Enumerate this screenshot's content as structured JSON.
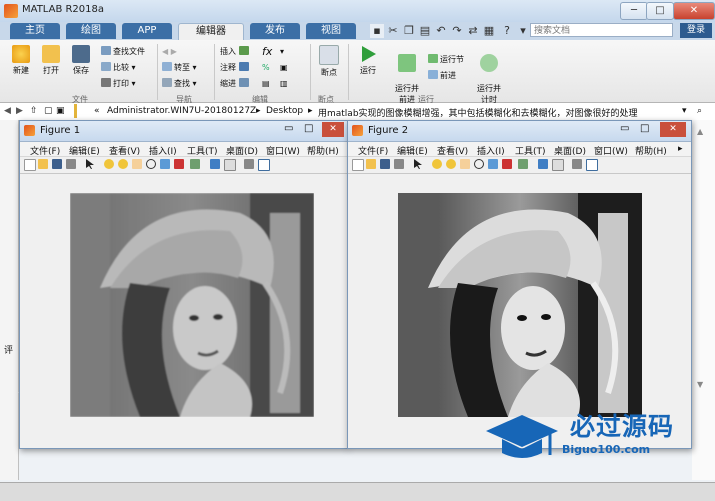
{
  "app": {
    "title": "MATLAB R2018a"
  },
  "window_controls": {
    "minimize": "─",
    "maximize": "□",
    "close": "✕"
  },
  "tabs": [
    {
      "label": "主页"
    },
    {
      "label": "绘图"
    },
    {
      "label": "APP"
    },
    {
      "label": "编辑器"
    },
    {
      "label": "发布"
    },
    {
      "label": "视图"
    }
  ],
  "search": {
    "placeholder": "搜索文档"
  },
  "login_label": "登录",
  "ribbon": {
    "new": "新建",
    "open": "打开",
    "save": "保存",
    "find_files": "查找文件",
    "compare": "比较",
    "print": "打印",
    "goto": "转至",
    "find": "查找",
    "insert": "插入",
    "comment": "注释",
    "indent": "缩进",
    "breakpoints": "断点",
    "run": "运行",
    "run_advance": "运行并\n前进",
    "run_section": "运行节",
    "advance": "前进",
    "run_time": "运行并\n计时",
    "sections": {
      "file": "文件",
      "navigate": "导航",
      "edit": "编辑",
      "breakpoints": "断点",
      "run": "运行"
    }
  },
  "path": {
    "prefix": "«",
    "segments": [
      "Administrator.WIN7U-20180127Z",
      "Desktop",
      "用matlab实现的图像模糊增强，其中包括模糊化和去模糊化，对图像很好的处理"
    ]
  },
  "figures": [
    {
      "title": "Figure 1"
    },
    {
      "title": "Figure 2"
    }
  ],
  "menu_items": [
    "文件(F)",
    "编辑(E)",
    "查看(V)",
    "插入(I)",
    "工具(T)",
    "桌面(D)",
    "窗口(W)",
    "帮助(H)"
  ],
  "background_pane_text": "评",
  "watermark": {
    "text": "必过源码",
    "url_text": "Biguo100.com"
  },
  "colors": {
    "tab_dark": "#3c6fa6",
    "login": "#2d5b8f",
    "watermark_blue": "#1766b7"
  }
}
